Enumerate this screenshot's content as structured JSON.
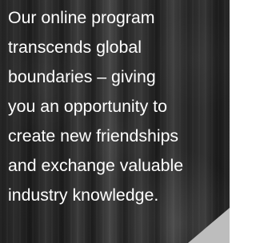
{
  "hero": {
    "lines": [
      "Our online program",
      "transcends global",
      "boundaries – giving",
      "you an opportunity to",
      "create new friendships",
      "and exchange valuable",
      "industry knowledge."
    ]
  }
}
